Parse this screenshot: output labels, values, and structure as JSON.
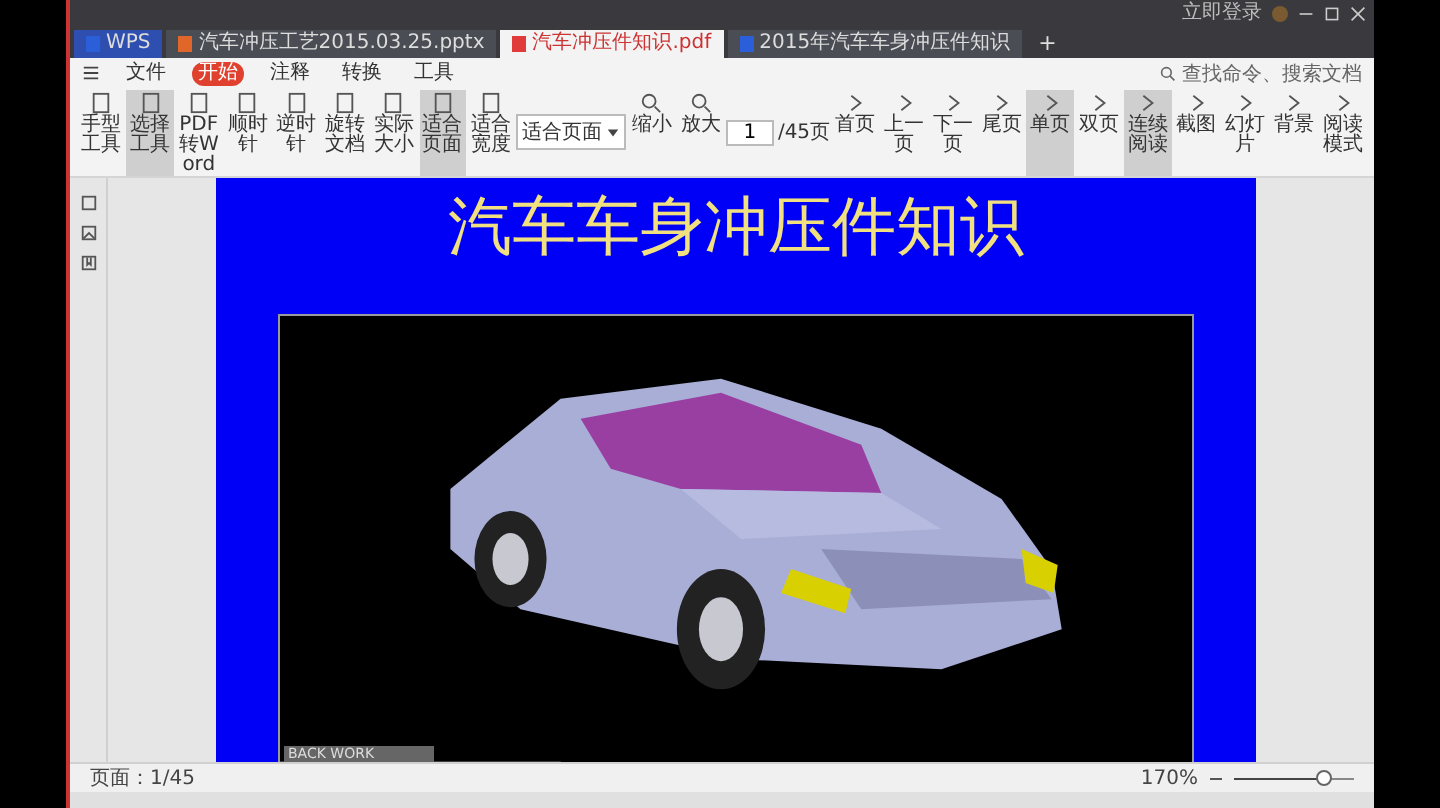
{
  "title_bar": {
    "user": "立即登录"
  },
  "tabs": [
    {
      "label": "WPS",
      "kind": "home",
      "selected": false
    },
    {
      "label": "汽车冲压工艺2015.03.25.pptx",
      "kind": "ppt",
      "selected": false
    },
    {
      "label": "汽车冲压件知识.pdf",
      "kind": "pdf",
      "selected": true
    },
    {
      "label": "2015年汽车车身冲压件知识",
      "kind": "doc",
      "selected": false
    }
  ],
  "new_tab": "+",
  "menu": {
    "file": "文件",
    "items": [
      {
        "label": "开始",
        "selected": true
      },
      {
        "label": "注释",
        "selected": false
      },
      {
        "label": "转换",
        "selected": false
      },
      {
        "label": "工具",
        "selected": false
      }
    ],
    "search": "查找命令、搜索文档"
  },
  "toolbar": [
    {
      "label": "手型工具",
      "selected": false
    },
    {
      "label": "选择工具",
      "selected": true
    },
    {
      "label": "PDF转Word",
      "selected": false
    },
    {
      "label": "顺时针",
      "selected": false
    },
    {
      "label": "逆时针",
      "selected": false
    },
    {
      "label": "旋转文档",
      "selected": false
    },
    {
      "label": "实际大小",
      "selected": false
    },
    {
      "label": "适合页面",
      "selected": true
    },
    {
      "label": "适合宽度",
      "selected": false
    },
    {
      "label": "缩小",
      "selected": false
    },
    {
      "label": "放大",
      "selected": false
    },
    {
      "label": "首页",
      "selected": false
    },
    {
      "label": "上一页",
      "selected": false
    },
    {
      "label": "下一页",
      "selected": false
    },
    {
      "label": "尾页",
      "selected": false
    },
    {
      "label": "单页",
      "selected": true
    },
    {
      "label": "双页",
      "selected": false
    },
    {
      "label": "连续阅读",
      "selected": true
    },
    {
      "label": "截图",
      "selected": false
    },
    {
      "label": "幻灯片",
      "selected": false
    },
    {
      "label": "背景",
      "selected": false
    },
    {
      "label": "阅读模式",
      "selected": false
    }
  ],
  "zoom_select": "适合页面",
  "page_field": {
    "value": "1",
    "total": "/45页"
  },
  "slide": {
    "title": "汽车车身冲压件知识",
    "caption": "BACK WORK"
  },
  "status_bar": {
    "page": "页面：1/45",
    "zoom": "170%",
    "level": 0.75
  }
}
